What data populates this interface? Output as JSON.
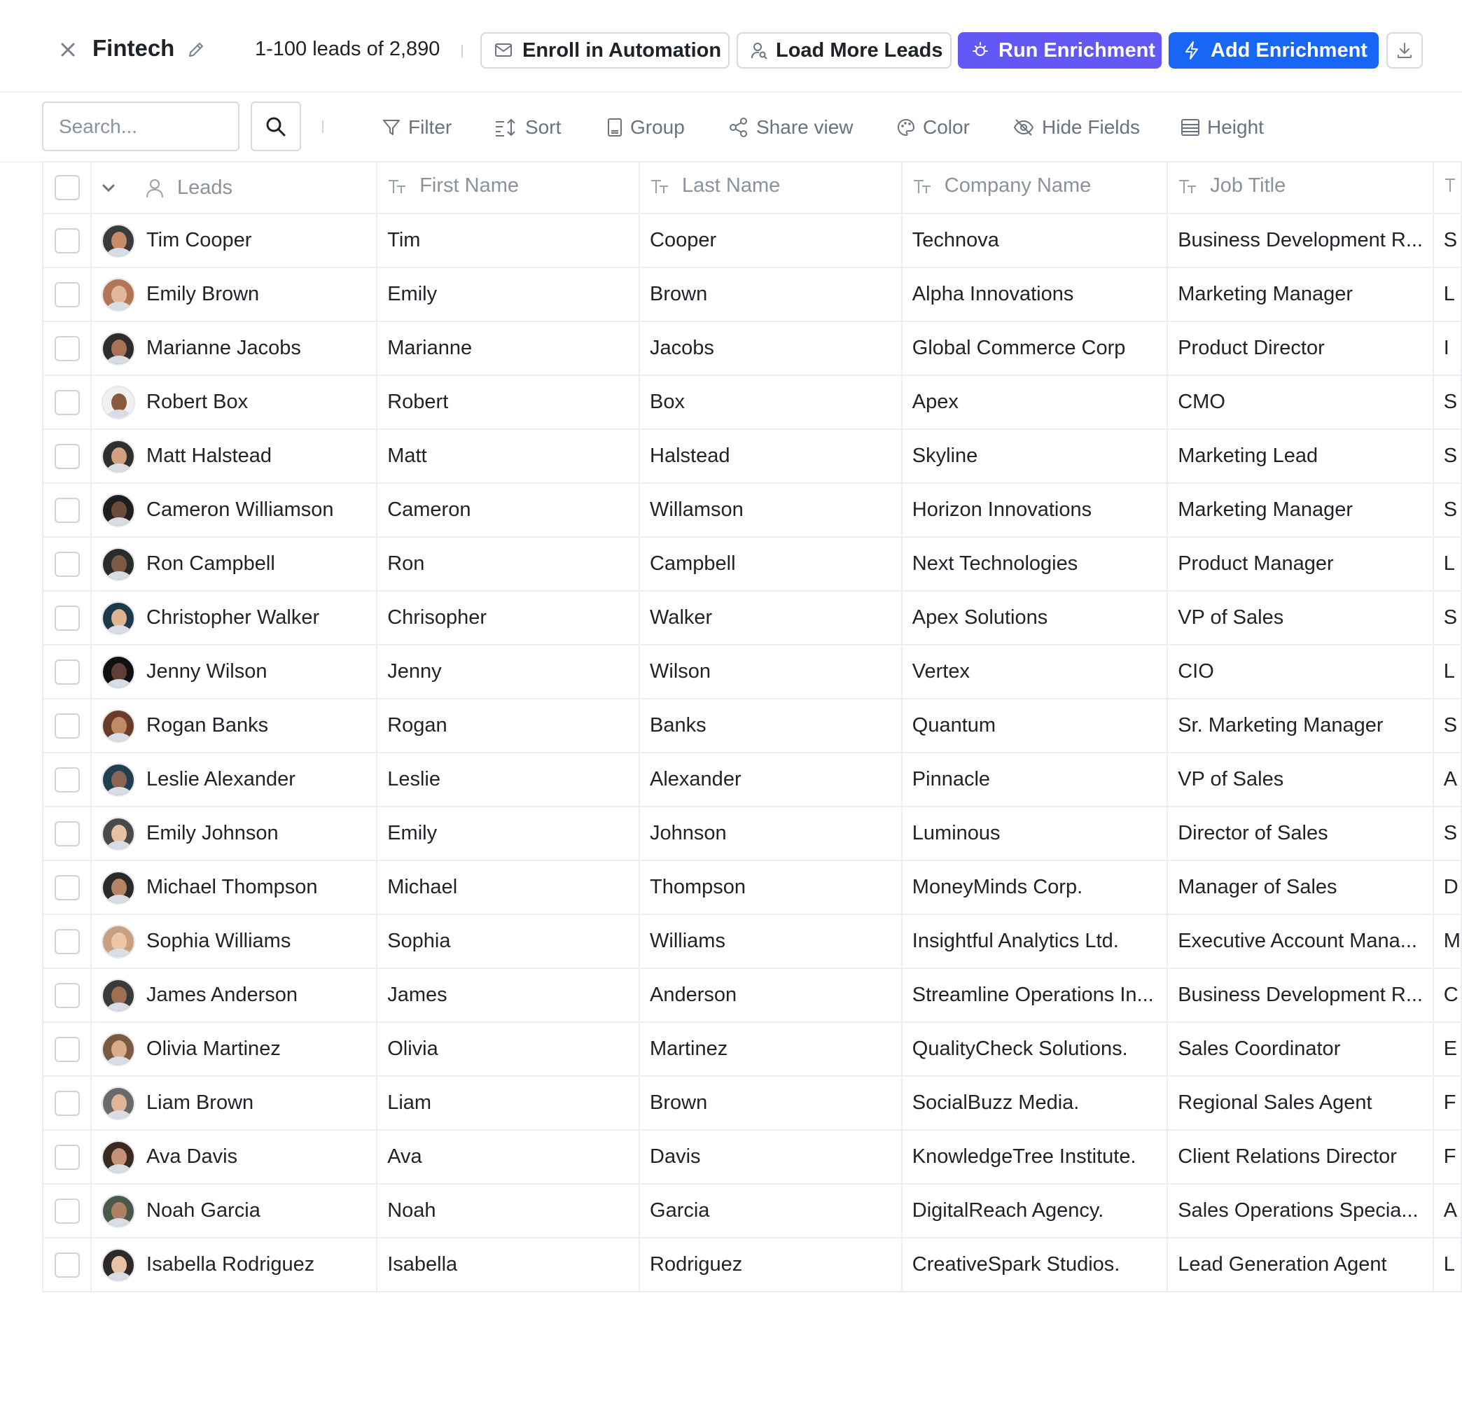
{
  "header": {
    "title": "Fintech",
    "lead_count": "1-100 leads of 2,890",
    "enroll_label": "Enroll in Automation",
    "load_more_label": "Load More Leads",
    "run_enrichment_label": "Run Enrichment",
    "add_enrichment_label": "Add Enrichment",
    "colors": {
      "run_enrichment": "#6357f5",
      "add_enrichment": "#1766f5"
    }
  },
  "toolbar": {
    "search_placeholder": "Search...",
    "filter_label": "Filter",
    "sort_label": "Sort",
    "group_label": "Group",
    "share_label": "Share view",
    "color_label": "Color",
    "hide_fields_label": "Hide Fields",
    "height_label": "Height"
  },
  "table": {
    "columns": [
      "Leads",
      "First Name",
      "Last Name",
      "Company Name",
      "Job Title"
    ],
    "rows": [
      {
        "lead": "Tim Cooper",
        "first": "Tim",
        "last": "Cooper",
        "company": "Technova",
        "title": "Business Development R...",
        "extra": "S"
      },
      {
        "lead": "Emily Brown",
        "first": "Emily",
        "last": "Brown",
        "company": "Alpha Innovations",
        "title": "Marketing Manager",
        "extra": "L"
      },
      {
        "lead": "Marianne Jacobs",
        "first": "Marianne",
        "last": "Jacobs",
        "company": "Global Commerce Corp",
        "title": "Product Director",
        "extra": "I"
      },
      {
        "lead": "Robert Box",
        "first": "Robert",
        "last": "Box",
        "company": "Apex",
        "title": "CMO",
        "extra": "S"
      },
      {
        "lead": "Matt Halstead",
        "first": "Matt",
        "last": "Halstead",
        "company": "Skyline",
        "title": "Marketing Lead",
        "extra": "S"
      },
      {
        "lead": "Cameron Williamson",
        "first": "Cameron",
        "last": "Willamson",
        "company": "Horizon Innovations",
        "title": "Marketing Manager",
        "extra": "S"
      },
      {
        "lead": "Ron Campbell",
        "first": "Ron",
        "last": "Campbell",
        "company": "Next Technologies",
        "title": "Product Manager",
        "extra": "L"
      },
      {
        "lead": "Christopher Walker",
        "first": "Chrisopher",
        "last": "Walker",
        "company": "Apex Solutions",
        "title": "VP of Sales",
        "extra": "S"
      },
      {
        "lead": "Jenny Wilson",
        "first": "Jenny",
        "last": "Wilson",
        "company": "Vertex",
        "title": "CIO",
        "extra": "L"
      },
      {
        "lead": "Rogan Banks",
        "first": "Rogan",
        "last": "Banks",
        "company": "Quantum",
        "title": "Sr. Marketing Manager",
        "extra": "S"
      },
      {
        "lead": "Leslie Alexander",
        "first": "Leslie",
        "last": "Alexander",
        "company": "Pinnacle",
        "title": "VP of Sales",
        "extra": "A"
      },
      {
        "lead": "Emily Johnson",
        "first": "Emily",
        "last": "Johnson",
        "company": "Luminous",
        "title": "Director of Sales",
        "extra": "S"
      },
      {
        "lead": "Michael Thompson",
        "first": "Michael",
        "last": "Thompson",
        "company": "MoneyMinds Corp.",
        "title": "Manager of Sales",
        "extra": "D"
      },
      {
        "lead": "Sophia Williams",
        "first": "Sophia",
        "last": "Williams",
        "company": "Insightful Analytics Ltd.",
        "title": "Executive Account Mana...",
        "extra": "M"
      },
      {
        "lead": "James Anderson",
        "first": "James",
        "last": "Anderson",
        "company": "Streamline Operations In...",
        "title": "Business Development R...",
        "extra": "C"
      },
      {
        "lead": "Olivia Martinez",
        "first": "Olivia",
        "last": "Martinez",
        "company": "QualityCheck Solutions.",
        "title": "Sales Coordinator",
        "extra": "E"
      },
      {
        "lead": "Liam Brown",
        "first": "Liam",
        "last": "Brown",
        "company": "SocialBuzz Media.",
        "title": "Regional Sales Agent",
        "extra": "F"
      },
      {
        "lead": "Ava Davis",
        "first": "Ava",
        "last": "Davis",
        "company": "KnowledgeTree Institute.",
        "title": "Client Relations Director",
        "extra": "F"
      },
      {
        "lead": "Noah Garcia",
        "first": "Noah",
        "last": "Garcia",
        "company": "DigitalReach Agency.",
        "title": "Sales Operations Specia...",
        "extra": "A"
      },
      {
        "lead": "Isabella Rodriguez",
        "first": "Isabella",
        "last": "Rodriguez",
        "company": "CreativeSpark Studios.",
        "title": "Lead Generation Agent",
        "extra": "L"
      }
    ]
  }
}
